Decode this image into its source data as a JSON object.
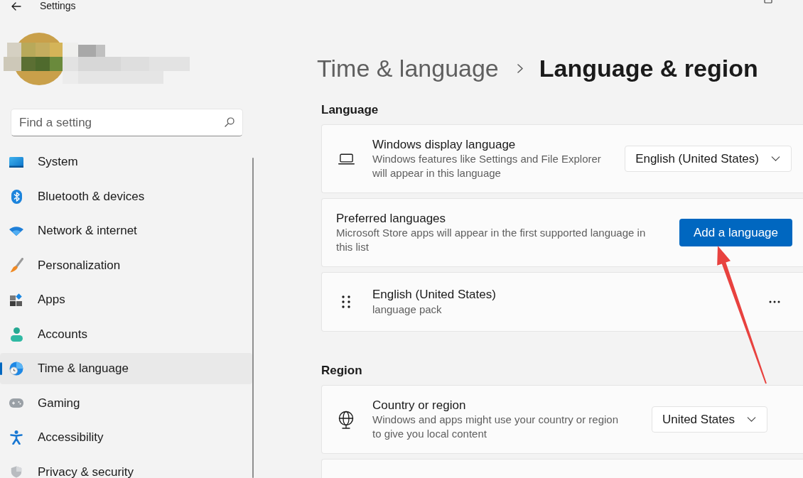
{
  "window": {
    "title": "Settings"
  },
  "search": {
    "placeholder": "Find a setting"
  },
  "sidebar": {
    "items": [
      {
        "label": "System",
        "selected": false
      },
      {
        "label": "Bluetooth & devices",
        "selected": false
      },
      {
        "label": "Network & internet",
        "selected": false
      },
      {
        "label": "Personalization",
        "selected": false
      },
      {
        "label": "Apps",
        "selected": false
      },
      {
        "label": "Accounts",
        "selected": false
      },
      {
        "label": "Time & language",
        "selected": true
      },
      {
        "label": "Gaming",
        "selected": false
      },
      {
        "label": "Accessibility",
        "selected": false
      },
      {
        "label": "Privacy & security",
        "selected": false
      }
    ]
  },
  "breadcrumb": {
    "parent": "Time & language",
    "current": "Language & region"
  },
  "sections": [
    {
      "heading": "Language",
      "cards": [
        {
          "kind": "setting",
          "title": "Windows display language",
          "description": "Windows features like Settings and File Explorer will appear in this language",
          "control": {
            "kind": "dropdown",
            "value": "English (United States)"
          }
        },
        {
          "kind": "setting",
          "title": "Preferred languages",
          "description": "Microsoft Store apps will appear in the first supported language in this list",
          "control": {
            "kind": "button",
            "label": "Add a language"
          }
        },
        {
          "kind": "language",
          "title": "English (United States)",
          "subtitle": "language pack"
        }
      ]
    },
    {
      "heading": "Region",
      "cards": [
        {
          "kind": "setting",
          "title": "Country or region",
          "description": "Windows and apps might use your country or region to give you local content",
          "control": {
            "kind": "dropdown",
            "value": "United States"
          }
        },
        {
          "kind": "setting"
        }
      ]
    }
  ]
}
